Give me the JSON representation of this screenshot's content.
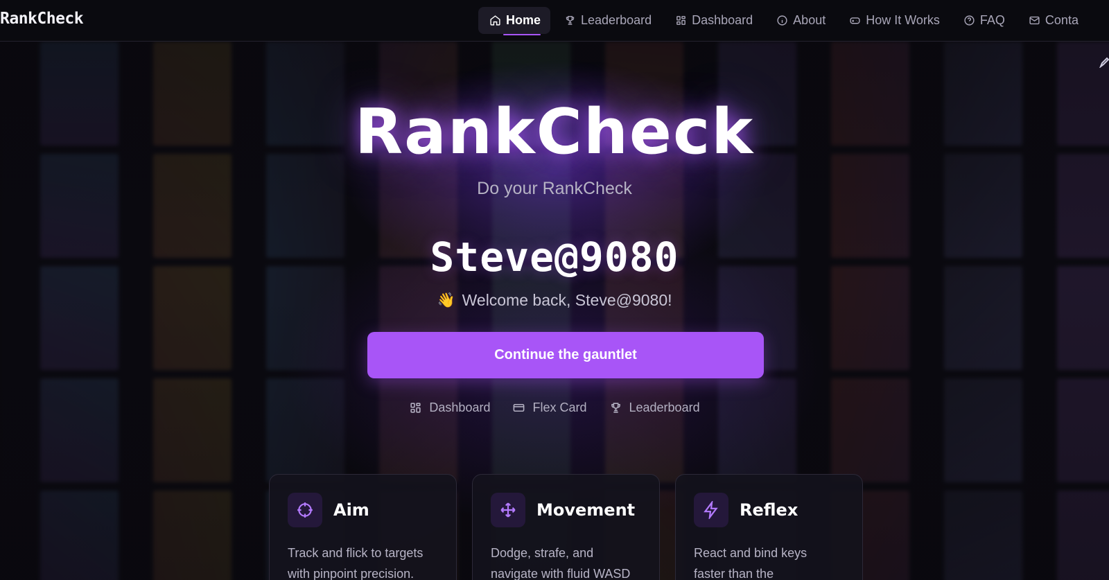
{
  "brand": "RankCheck",
  "nav": {
    "items": [
      {
        "label": "Home",
        "icon": "home-icon",
        "active": true
      },
      {
        "label": "Leaderboard",
        "icon": "trophy-icon",
        "active": false
      },
      {
        "label": "Dashboard",
        "icon": "grid-icon",
        "active": false
      },
      {
        "label": "About",
        "icon": "info-icon",
        "active": false
      },
      {
        "label": "How It Works",
        "icon": "gamepad-icon",
        "active": false
      },
      {
        "label": "FAQ",
        "icon": "question-icon",
        "active": false
      },
      {
        "label": "Conta",
        "icon": "mail-icon",
        "active": false
      }
    ]
  },
  "hero": {
    "title": "RankCheck",
    "subtitle": "Do your RankCheck",
    "username": "Steve@9080",
    "welcome_emoji": "👋",
    "welcome": "Welcome back, Steve@9080!",
    "cta": "Continue the gauntlet"
  },
  "quick_links": [
    {
      "label": "Dashboard",
      "icon": "grid-icon"
    },
    {
      "label": "Flex Card",
      "icon": "card-icon"
    },
    {
      "label": "Leaderboard",
      "icon": "trophy-icon"
    }
  ],
  "cards": [
    {
      "title": "Aim",
      "icon": "crosshair-icon",
      "desc_line1": "Track and flick to targets",
      "desc_line2": "with pinpoint precision."
    },
    {
      "title": "Movement",
      "icon": "move-icon",
      "desc_line1": "Dodge, strafe, and",
      "desc_line2": "navigate with fluid WASD"
    },
    {
      "title": "Reflex",
      "icon": "lightning-icon",
      "desc_line1": "React and bind keys",
      "desc_line2": "faster than the"
    }
  ],
  "colors": {
    "accent": "#a855f7",
    "background": "#0b0a10",
    "nav_active_bg": "#1d1b27"
  }
}
